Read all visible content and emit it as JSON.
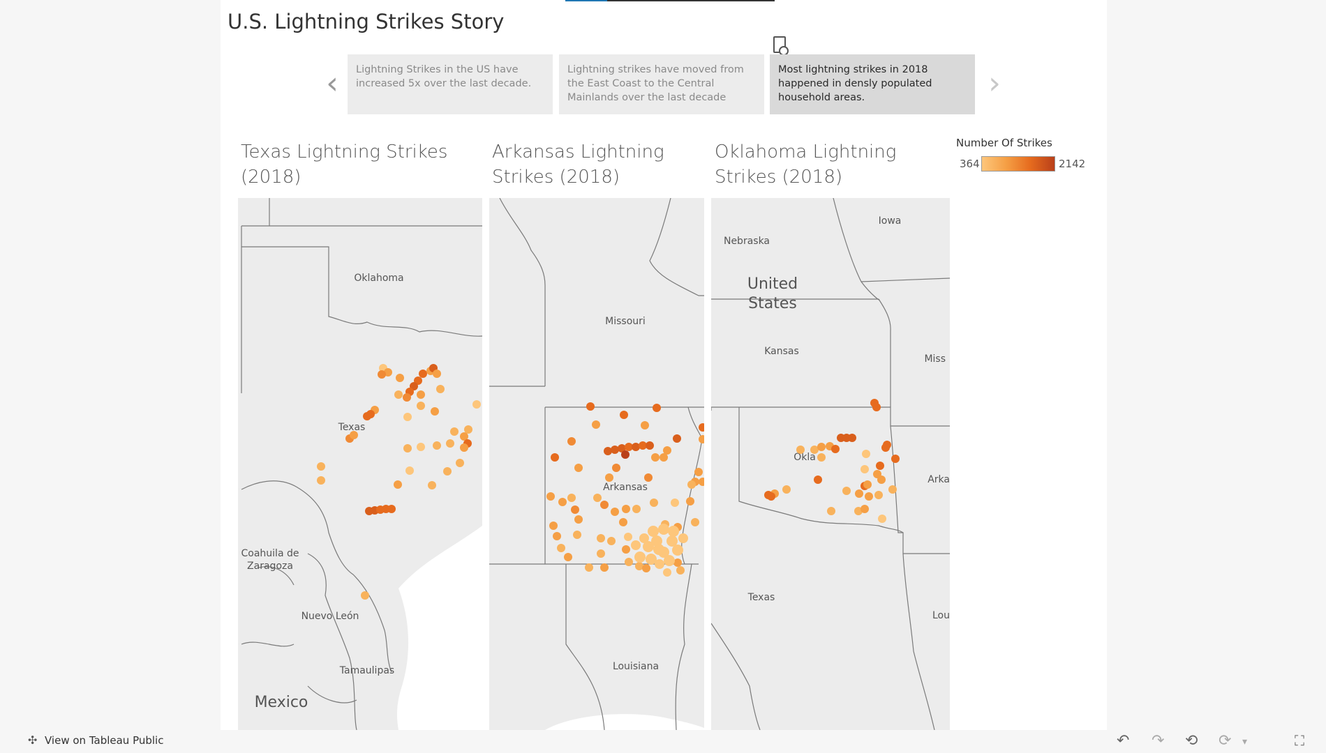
{
  "story": {
    "title": "U.S. Lightning Strikes Story",
    "prev_arrow": "‹",
    "next_arrow": "›",
    "points": [
      {
        "text": "Lightning Strikes in the US have increased 5x over the last decade."
      },
      {
        "text": "Lightning strikes have moved from the East Coast to the Central Mainlands over the last decade"
      },
      {
        "text": "Most lightning strikes in 2018 happened in densly populated household areas."
      }
    ]
  },
  "maps": {
    "texas": {
      "title": "Texas Lightning Strikes (2018)",
      "labels": [
        "Oklahoma",
        "Texas",
        "Coahuila de",
        "Zaragoza",
        "Nuevo León",
        "Tamaulipas",
        "Mexico"
      ]
    },
    "arkansas": {
      "title": "Arkansas Lightning Strikes (2018)",
      "labels": [
        "Missouri",
        "Arkansas",
        "Louisiana"
      ]
    },
    "oklahoma": {
      "title": "Oklahoma Lightning Strikes (2018)",
      "labels": [
        "Iowa",
        "Nebraska",
        "United",
        "States",
        "Kansas",
        "Miss",
        "Okla",
        "Arka",
        "Texas",
        "Lou"
      ]
    }
  },
  "legend": {
    "title": "Number Of Strikes",
    "min": "364",
    "max": "2142",
    "colors": [
      "#fdc67b",
      "#f59f45",
      "#e66b1e",
      "#b9401a"
    ]
  },
  "footer": {
    "view_public": "View on Tableau Public"
  },
  "icons": {
    "prev": "chevron-left-icon",
    "next": "chevron-right-icon",
    "undo": "undo-icon",
    "redo": "redo-icon",
    "revert": "revert-icon",
    "refresh": "refresh-icon",
    "fullscreen": "fullscreen-icon",
    "tableau": "tableau-logo-icon"
  }
}
